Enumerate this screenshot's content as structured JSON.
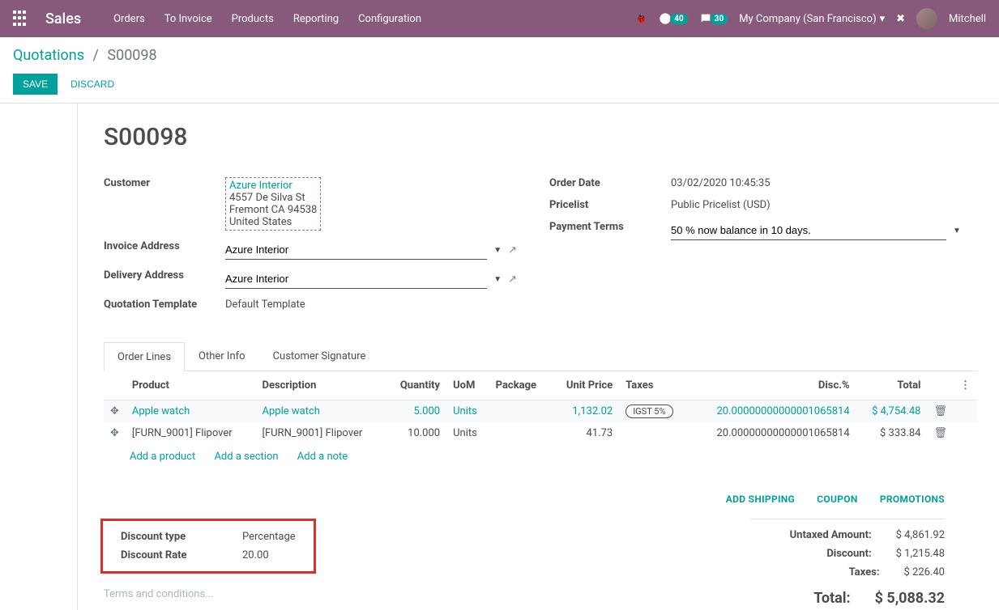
{
  "nav": {
    "brand": "Sales",
    "items": [
      "Orders",
      "To Invoice",
      "Products",
      "Reporting",
      "Configuration"
    ],
    "clock_badge": "40",
    "chat_badge": "30",
    "company": "My Company (San Francisco)",
    "user": "Mitchell"
  },
  "breadcrumb": {
    "parent": "Quotations",
    "current": "S00098"
  },
  "buttons": {
    "save": "SAVE",
    "discard": "DISCARD"
  },
  "record": {
    "name": "S00098",
    "customer_label": "Customer",
    "customer_name": "Azure Interior",
    "customer_addr1": "4557 De Silva St",
    "customer_addr2": "Fremont CA 94538",
    "customer_addr3": "United States",
    "invoice_label": "Invoice Address",
    "invoice_value": "Azure Interior",
    "delivery_label": "Delivery Address",
    "delivery_value": "Azure Interior",
    "template_label": "Quotation Template",
    "template_value": "Default Template",
    "order_date_label": "Order Date",
    "order_date_value": "03/02/2020 10:45:35",
    "pricelist_label": "Pricelist",
    "pricelist_value": "Public Pricelist (USD)",
    "payment_label": "Payment Terms",
    "payment_value": "50 % now balance in 10 days."
  },
  "tabs": [
    "Order Lines",
    "Other Info",
    "Customer Signature"
  ],
  "cols": {
    "product": "Product",
    "desc": "Description",
    "qty": "Quantity",
    "uom": "UoM",
    "pkg": "Package",
    "price": "Unit Price",
    "taxes": "Taxes",
    "disc": "Disc.%",
    "total": "Total"
  },
  "lines": [
    {
      "product": "Apple watch",
      "desc": "Apple watch",
      "qty": "5.000",
      "uom": "Units",
      "pkg": "",
      "price": "1,132.02",
      "tax": "IGST 5%",
      "disc": "20.00000000000001065814",
      "total": "$ 4,754.48",
      "hover": true
    },
    {
      "product": "[FURN_9001] Flipover",
      "desc": "[FURN_9001] Flipover",
      "qty": "10.000",
      "uom": "Units",
      "pkg": "",
      "price": "41.73",
      "tax": "",
      "disc": "20.00000000000001065814",
      "total": "$ 333.84",
      "hover": false
    }
  ],
  "addlinks": {
    "product": "Add a product",
    "section": "Add a section",
    "note": "Add a note"
  },
  "actions": {
    "shipping": "ADD SHIPPING",
    "coupon": "COUPON",
    "promo": "PROMOTIONS"
  },
  "discount": {
    "type_label": "Discount type",
    "type_value": "Percentage",
    "rate_label": "Discount Rate",
    "rate_value": "20.00"
  },
  "terms_placeholder": "Terms and conditions...",
  "totals": {
    "untaxed_label": "Untaxed Amount:",
    "untaxed_value": "$ 4,861.92",
    "disc_label": "Discount:",
    "disc_value": "$ 1,215.48",
    "tax_label": "Taxes:",
    "tax_value": "$ 226.40",
    "total_label": "Total:",
    "total_value": "$ 5,088.32"
  }
}
